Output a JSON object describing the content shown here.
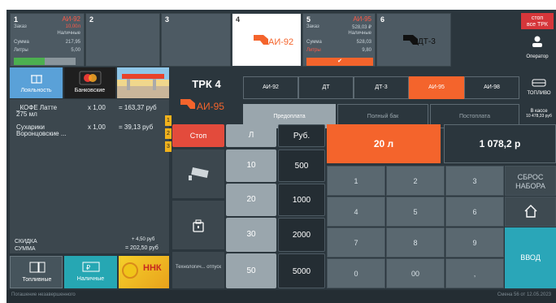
{
  "pumps": [
    {
      "num": "1",
      "fuel": "АИ-92",
      "order_label": "Заказ",
      "order_value": "10,00л",
      "payment": "Наличные",
      "sum_label": "Сумма",
      "sum_value": "217,95",
      "liters_label": "Литры",
      "liters_value": "5,00",
      "progress": 0.5
    },
    {
      "num": "2"
    },
    {
      "num": "3"
    },
    {
      "num": "4",
      "nozzle_label": "АИ-92"
    },
    {
      "num": "5",
      "fuel": "АИ-95",
      "order_label": "Заказ",
      "order_value": "528,03 ₽",
      "payment": "Наличные",
      "sum_label": "Сумма",
      "sum_value": "528,03",
      "liters_label": "Литры",
      "liters_value": "9,80",
      "check": "✔"
    },
    {
      "num": "6",
      "nozzle_label": "ДТ-3"
    }
  ],
  "stop_all": {
    "line1": "стоп",
    "line2": "все ТРК"
  },
  "operator": {
    "label": "Оператор"
  },
  "left_buttons": {
    "loyalty": "Лояльность",
    "bank": "Банковские",
    "fuel": "Топливные",
    "cash": "Наличные"
  },
  "receipt": {
    "items": [
      {
        "name": "_КОФЕ Латте",
        "name2": "275 мл",
        "qty": "x 1,00",
        "total": "= 163,37 руб"
      },
      {
        "name": "Сухарики",
        "name2": "Воронцовские ...",
        "qty": "x 1,00",
        "total": "= 39,13 руб"
      }
    ],
    "tabs": [
      "1",
      "2",
      "3"
    ],
    "discount_label": "СКИДКА",
    "discount_value": "+ 4,50 руб",
    "total_label": "СУММА",
    "total_value": "= 202,50 руб"
  },
  "trk": {
    "title": "ТРК 4",
    "nozzle_label": "АИ-95"
  },
  "fuel_tabs": [
    "АИ-92",
    "ДТ",
    "ДТ-3",
    "АИ-95",
    "АИ-98"
  ],
  "fuel_tab_active": "АИ-95",
  "fuel_side": {
    "label": "ТОПЛИВО"
  },
  "modes": [
    "Предоплата",
    "Полный бак",
    "Постоплата"
  ],
  "in_cash": {
    "label": "В кассе",
    "value": "10 478,33 руб"
  },
  "controls": {
    "stop": "Стоп",
    "liters": "Л",
    "rubles": "Руб.",
    "tech_release": "Технологич... отпуск"
  },
  "presets_liters": [
    "10",
    "20",
    "30",
    "50"
  ],
  "presets_rubles": [
    "500",
    "1000",
    "2000",
    "5000"
  ],
  "display": {
    "liters": "20 л",
    "amount": "1 078,2 р"
  },
  "keypad": {
    "rows": [
      [
        "1",
        "2",
        "3"
      ],
      [
        "4",
        "5",
        "6"
      ],
      [
        "7",
        "8",
        "9"
      ],
      [
        "0",
        "00",
        ","
      ]
    ],
    "reset": "СБРОС НАБОРА",
    "enter": "ВВОД"
  },
  "status": {
    "left": "Погашение незавершенного",
    "right": "Смена 56 от 12.05.2023"
  },
  "colors": {
    "accent": "#f4642c",
    "background": "#2b363d",
    "progress": "#4caf50",
    "warning": "#f2b21b",
    "stop": "#d6363a",
    "enter": "#2aa6b8"
  }
}
